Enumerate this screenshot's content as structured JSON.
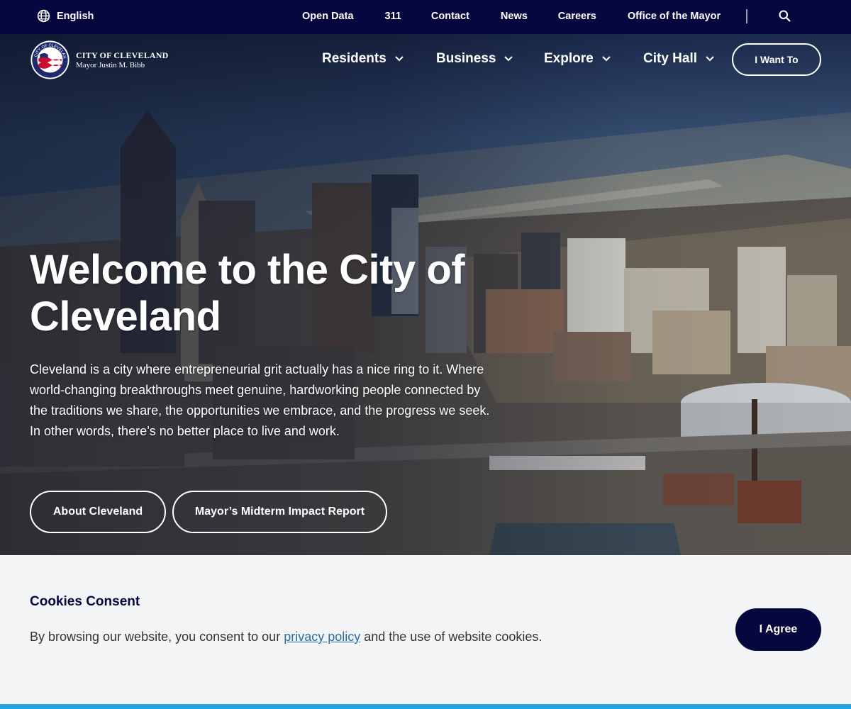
{
  "utility": {
    "language": "English",
    "links": [
      "Open Data",
      "311",
      "Contact",
      "News",
      "Careers",
      "Office of the Mayor"
    ],
    "separator": "|",
    "icons": {
      "language": "globe-icon",
      "search": "search-icon"
    }
  },
  "logo": {
    "seal_text": "CITY OF CLEVELAND OHIO",
    "city": "CITY OF CLEVELAND",
    "mayor": "Mayor Justin M. Bibb"
  },
  "nav": {
    "items": [
      "Residents",
      "Business",
      "Explore",
      "City Hall"
    ],
    "cta": "I Want To"
  },
  "hero": {
    "title": "Welcome to the City of Cleveland",
    "description": "Cleveland is a city where entrepreneurial grit actually has a nice ring to it. Where world-changing breakthroughs meet genuine, hardworking people connected by the traditions we share, the opportunities we embrace, and the progress we seek. In other words, there’s no better place to live and work.",
    "buttons": [
      "About Cleveland",
      "Mayor’s Midterm Impact Report"
    ]
  },
  "cookies": {
    "title": "Cookies Consent",
    "text_before": "By browsing our website, you consent to our ",
    "link": "privacy policy",
    "text_after": " and the use of website cookies.",
    "button": "I Agree"
  },
  "colors": {
    "navy": "#07073f",
    "link_blue": "#2f6aa8",
    "stripe": "#28a3e0",
    "background": "#f3f4f6"
  }
}
